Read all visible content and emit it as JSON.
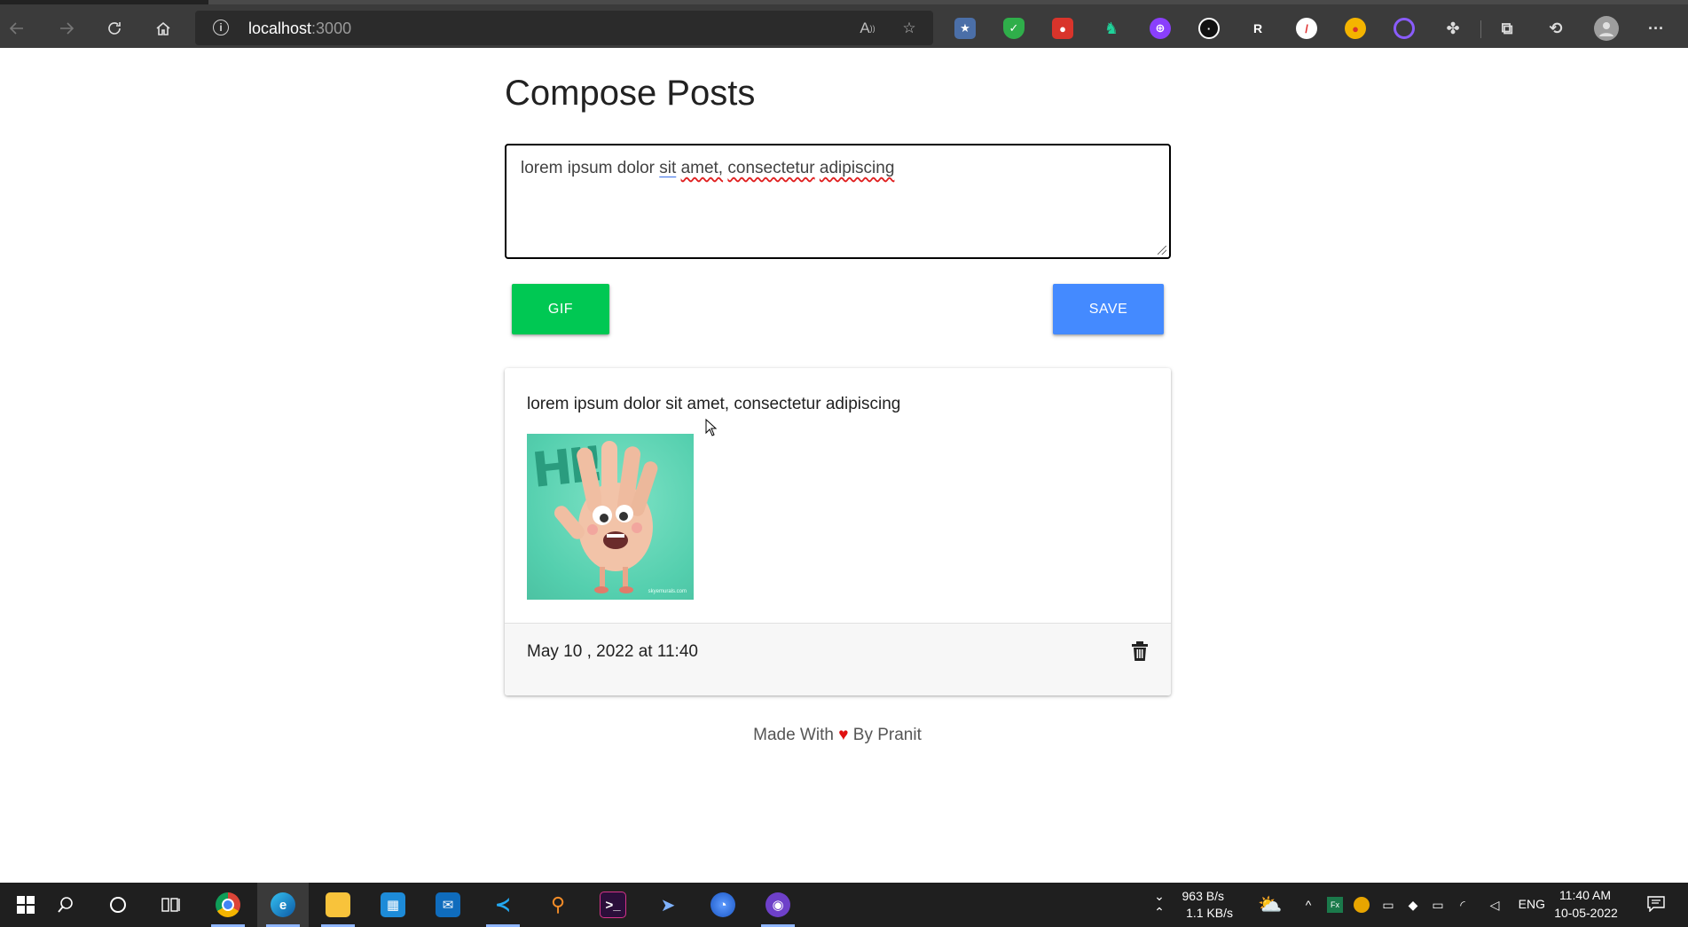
{
  "browser": {
    "url_host": "localhost",
    "url_port": ":3000"
  },
  "page": {
    "title": "Compose Posts",
    "compose": {
      "text_parts": [
        "lorem ipsum dolor ",
        "sit",
        " ",
        "amet,",
        " ",
        "consectetur",
        " ",
        "adipiscing"
      ]
    },
    "buttons": {
      "gif_label": "GIF",
      "save_label": "SAVE"
    },
    "post": {
      "text": "lorem ipsum dolor sit amet, consectetur adipiscing",
      "gif_text": "HI!",
      "gif_credit": "skyemurals.com",
      "date": "May 10 , 2022 at 11:40"
    },
    "footer": {
      "prefix": "Made With",
      "heart": "♥",
      "suffix": "By Pranit"
    }
  },
  "taskbar": {
    "net_down": "963 B/s",
    "net_up": "1.1 KB/s",
    "lang": "ENG",
    "time": "11:40 AM",
    "date": "10-05-2022"
  },
  "colors": {
    "gif_button": "#00c853",
    "save_button": "#448aff",
    "heart": "#e01010"
  }
}
